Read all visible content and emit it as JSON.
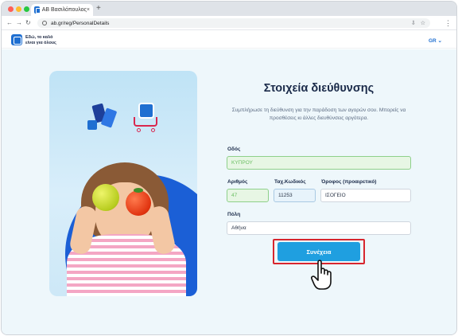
{
  "browser": {
    "tab_title": "AB Βασιλόπουλος",
    "tab_close": "×",
    "new_tab": "+",
    "url": "ab.gr/reg/PersonalDetails",
    "menu": "⋮"
  },
  "site": {
    "tagline_line1": "Εδώ, το καλό",
    "tagline_line2": "είναι για όλους",
    "language": "GR ⌄"
  },
  "form": {
    "title": "Στοιχεία διεύθυνσης",
    "subtitle": "Συμπλήρωσε τη διεύθυνση για την παράδοση των αγορών σου. Μπορείς να προσθέσεις κι άλλες διευθύνσεις αργότερα.",
    "street_label": "Οδός",
    "street_value": "ΚΥΠΡΟΥ",
    "number_label": "Αριθμός",
    "number_value": "47",
    "zip_label": "Ταχ.Κωδικός",
    "zip_value": "11253",
    "floor_label": "Όροφος (προαιρετικό)",
    "floor_value": "ΙΣΟΓΕΙΟ",
    "city_label": "Πόλη",
    "city_value": "Αθήνα",
    "submit_label": "Συνέχεια"
  },
  "colors": {
    "accent": "#1f9fe0",
    "brand": "#1f6fd1",
    "highlight": "#d7262e",
    "valid_field": "#e7f6e4"
  }
}
